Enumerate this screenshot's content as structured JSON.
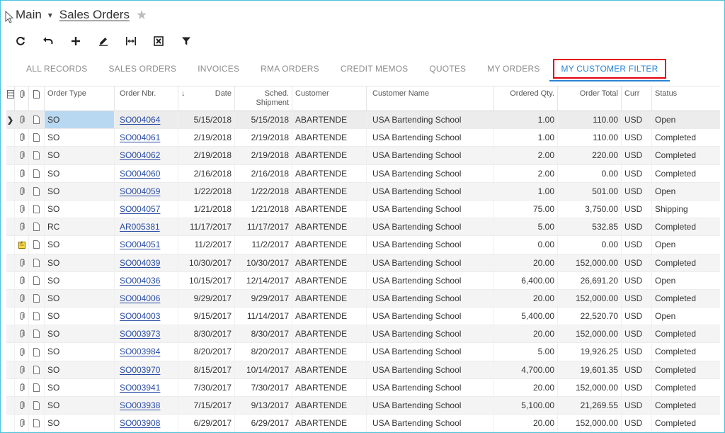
{
  "breadcrumb": {
    "root": "Main",
    "page": "Sales Orders"
  },
  "toolbar": {
    "buttons": [
      {
        "name": "refresh",
        "icon": "refresh-icon"
      },
      {
        "name": "undo",
        "icon": "undo-icon"
      },
      {
        "name": "add",
        "icon": "plus-icon"
      },
      {
        "name": "edit",
        "icon": "pencil-icon"
      },
      {
        "name": "fit-columns",
        "icon": "fit-width-icon"
      },
      {
        "name": "export-excel",
        "icon": "excel-icon"
      },
      {
        "name": "filter",
        "icon": "filter-icon"
      }
    ]
  },
  "tabs": [
    {
      "label": "ALL RECORDS",
      "active": false
    },
    {
      "label": "SALES ORDERS",
      "active": false
    },
    {
      "label": "INVOICES",
      "active": false
    },
    {
      "label": "RMA ORDERS",
      "active": false
    },
    {
      "label": "CREDIT MEMOS",
      "active": false
    },
    {
      "label": "QUOTES",
      "active": false
    },
    {
      "label": "MY ORDERS",
      "active": false
    },
    {
      "label": "MY CUSTOMER FILTER",
      "active": true
    }
  ],
  "grid": {
    "headers": {
      "order_type": "Order Type",
      "order_nbr": "Order Nbr.",
      "sort_arrow": "↓",
      "date": "Date",
      "sched_shipment_1": "Sched.",
      "sched_shipment_2": "Shipment",
      "customer": "Customer",
      "customer_name": "Customer Name",
      "ordered_qty": "Ordered Qty.",
      "order_total": "Order Total",
      "curr": "Curr",
      "status": "Status"
    },
    "rows": [
      {
        "type": "SO",
        "nbr": "SO004064",
        "date": "5/15/2018",
        "ship": "5/15/2018",
        "cust": "ABARTENDE",
        "name": "USA Bartending School",
        "qty": "1.00",
        "total": "110.00",
        "curr": "USD",
        "status": "Open",
        "selected": true,
        "attach": "paperclip"
      },
      {
        "type": "SO",
        "nbr": "SO004061",
        "date": "2/19/2018",
        "ship": "2/19/2018",
        "cust": "ABARTENDE",
        "name": "USA Bartending School",
        "qty": "1.00",
        "total": "110.00",
        "curr": "USD",
        "status": "Completed",
        "attach": "paperclip"
      },
      {
        "type": "SO",
        "nbr": "SO004062",
        "date": "2/19/2018",
        "ship": "2/19/2018",
        "cust": "ABARTENDE",
        "name": "USA Bartending School",
        "qty": "2.00",
        "total": "220.00",
        "curr": "USD",
        "status": "Completed",
        "attach": "paperclip"
      },
      {
        "type": "SO",
        "nbr": "SO004060",
        "date": "2/16/2018",
        "ship": "2/16/2018",
        "cust": "ABARTENDE",
        "name": "USA Bartending School",
        "qty": "2.00",
        "total": "0.00",
        "curr": "USD",
        "status": "Completed",
        "attach": "paperclip"
      },
      {
        "type": "SO",
        "nbr": "SO004059",
        "date": "1/22/2018",
        "ship": "1/22/2018",
        "cust": "ABARTENDE",
        "name": "USA Bartending School",
        "qty": "1.00",
        "total": "501.00",
        "curr": "USD",
        "status": "Open",
        "attach": "paperclip"
      },
      {
        "type": "SO",
        "nbr": "SO004057",
        "date": "1/21/2018",
        "ship": "1/21/2018",
        "cust": "ABARTENDE",
        "name": "USA Bartending School",
        "qty": "75.00",
        "total": "3,750.00",
        "curr": "USD",
        "status": "Shipping",
        "attach": "paperclip"
      },
      {
        "type": "RC",
        "nbr": "AR005381",
        "date": "11/17/2017",
        "ship": "11/17/2017",
        "cust": "ABARTENDE",
        "name": "USA Bartending School",
        "qty": "5.00",
        "total": "532.85",
        "curr": "USD",
        "status": "Completed",
        "attach": "paperclip"
      },
      {
        "type": "SO",
        "nbr": "SO004051",
        "date": "11/2/2017",
        "ship": "11/2/2017",
        "cust": "ABARTENDE",
        "name": "USA Bartending School",
        "qty": "0.00",
        "total": "0.00",
        "curr": "USD",
        "status": "Open",
        "attach": "note"
      },
      {
        "type": "SO",
        "nbr": "SO004039",
        "date": "10/30/2017",
        "ship": "10/30/2017",
        "cust": "ABARTENDE",
        "name": "USA Bartending School",
        "qty": "20.00",
        "total": "152,000.00",
        "curr": "USD",
        "status": "Completed",
        "attach": "paperclip"
      },
      {
        "type": "SO",
        "nbr": "SO004036",
        "date": "10/15/2017",
        "ship": "12/14/2017",
        "cust": "ABARTENDE",
        "name": "USA Bartending School",
        "qty": "6,400.00",
        "total": "26,691.20",
        "curr": "USD",
        "status": "Open",
        "attach": "paperclip"
      },
      {
        "type": "SO",
        "nbr": "SO004006",
        "date": "9/29/2017",
        "ship": "9/29/2017",
        "cust": "ABARTENDE",
        "name": "USA Bartending School",
        "qty": "20.00",
        "total": "152,000.00",
        "curr": "USD",
        "status": "Completed",
        "attach": "paperclip"
      },
      {
        "type": "SO",
        "nbr": "SO004003",
        "date": "9/15/2017",
        "ship": "11/14/2017",
        "cust": "ABARTENDE",
        "name": "USA Bartending School",
        "qty": "5,400.00",
        "total": "22,520.70",
        "curr": "USD",
        "status": "Open",
        "attach": "paperclip"
      },
      {
        "type": "SO",
        "nbr": "SO003973",
        "date": "8/30/2017",
        "ship": "8/30/2017",
        "cust": "ABARTENDE",
        "name": "USA Bartending School",
        "qty": "20.00",
        "total": "152,000.00",
        "curr": "USD",
        "status": "Completed",
        "attach": "paperclip"
      },
      {
        "type": "SO",
        "nbr": "SO003984",
        "date": "8/20/2017",
        "ship": "8/20/2017",
        "cust": "ABARTENDE",
        "name": "USA Bartending School",
        "qty": "5.00",
        "total": "19,926.25",
        "curr": "USD",
        "status": "Completed",
        "attach": "paperclip"
      },
      {
        "type": "SO",
        "nbr": "SO003970",
        "date": "8/15/2017",
        "ship": "10/14/2017",
        "cust": "ABARTENDE",
        "name": "USA Bartending School",
        "qty": "4,700.00",
        "total": "19,601.35",
        "curr": "USD",
        "status": "Completed",
        "attach": "paperclip"
      },
      {
        "type": "SO",
        "nbr": "SO003941",
        "date": "7/30/2017",
        "ship": "7/30/2017",
        "cust": "ABARTENDE",
        "name": "USA Bartending School",
        "qty": "20.00",
        "total": "152,000.00",
        "curr": "USD",
        "status": "Completed",
        "attach": "paperclip"
      },
      {
        "type": "SO",
        "nbr": "SO003938",
        "date": "7/15/2017",
        "ship": "9/13/2017",
        "cust": "ABARTENDE",
        "name": "USA Bartending School",
        "qty": "5,100.00",
        "total": "21,269.55",
        "curr": "USD",
        "status": "Completed",
        "attach": "paperclip"
      },
      {
        "type": "SO",
        "nbr": "SO003908",
        "date": "6/29/2017",
        "ship": "6/29/2017",
        "cust": "ABARTENDE",
        "name": "USA Bartending School",
        "qty": "20.00",
        "total": "152,000.00",
        "curr": "USD",
        "status": "Completed",
        "attach": "paperclip"
      }
    ]
  }
}
